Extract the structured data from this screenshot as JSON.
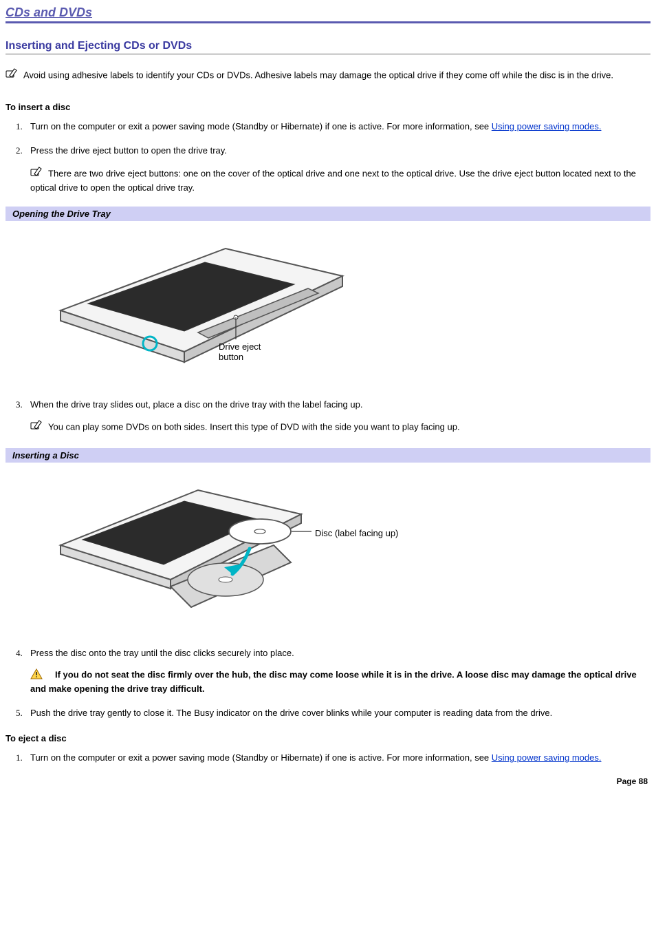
{
  "title": "CDs and DVDs",
  "section_title": "Inserting and Ejecting CDs or DVDs",
  "intro_note": "Avoid using adhesive labels to identify your CDs or DVDs. Adhesive labels may damage the optical drive if they come off while the disc is in the drive.",
  "insert_heading": "To insert a disc",
  "insert_steps": {
    "s1_a": "Turn on the computer or exit a power saving mode (Standby or Hibernate) if one is active. For more information, see ",
    "s1_link": "Using power saving modes.",
    "s2": "Press the drive eject button to open the drive tray.",
    "s2_note": "There are two drive eject buttons: one on the cover of the optical drive and one next to the optical drive. Use the drive eject button located next to the optical drive to open the optical drive tray.",
    "s3": "When the drive tray slides out, place a disc on the drive tray with the label facing up.",
    "s3_note": "You can play some DVDs on both sides. Insert this type of DVD with the side you want to play facing up.",
    "s4": "Press the disc onto the tray until the disc clicks securely into place.",
    "s4_warning": "If you do not seat the disc firmly over the hub, the disc may come loose while it is in the drive. A loose disc may damage the optical drive and make opening the drive tray difficult.",
    "s5": "Push the drive tray gently to close it. The Busy indicator on the drive cover blinks while your computer is reading data from the drive."
  },
  "fig1_caption": "Opening the Drive Tray",
  "fig1_label": "Drive eject\nbutton",
  "fig2_caption": "Inserting a Disc",
  "fig2_label": "Disc (label facing up)",
  "eject_heading": "To eject a disc",
  "eject_steps": {
    "s1_a": "Turn on the computer or exit a power saving mode (Standby or Hibernate) if one is active. For more information, see ",
    "s1_link": "Using power saving modes."
  },
  "page_number": "Page 88"
}
